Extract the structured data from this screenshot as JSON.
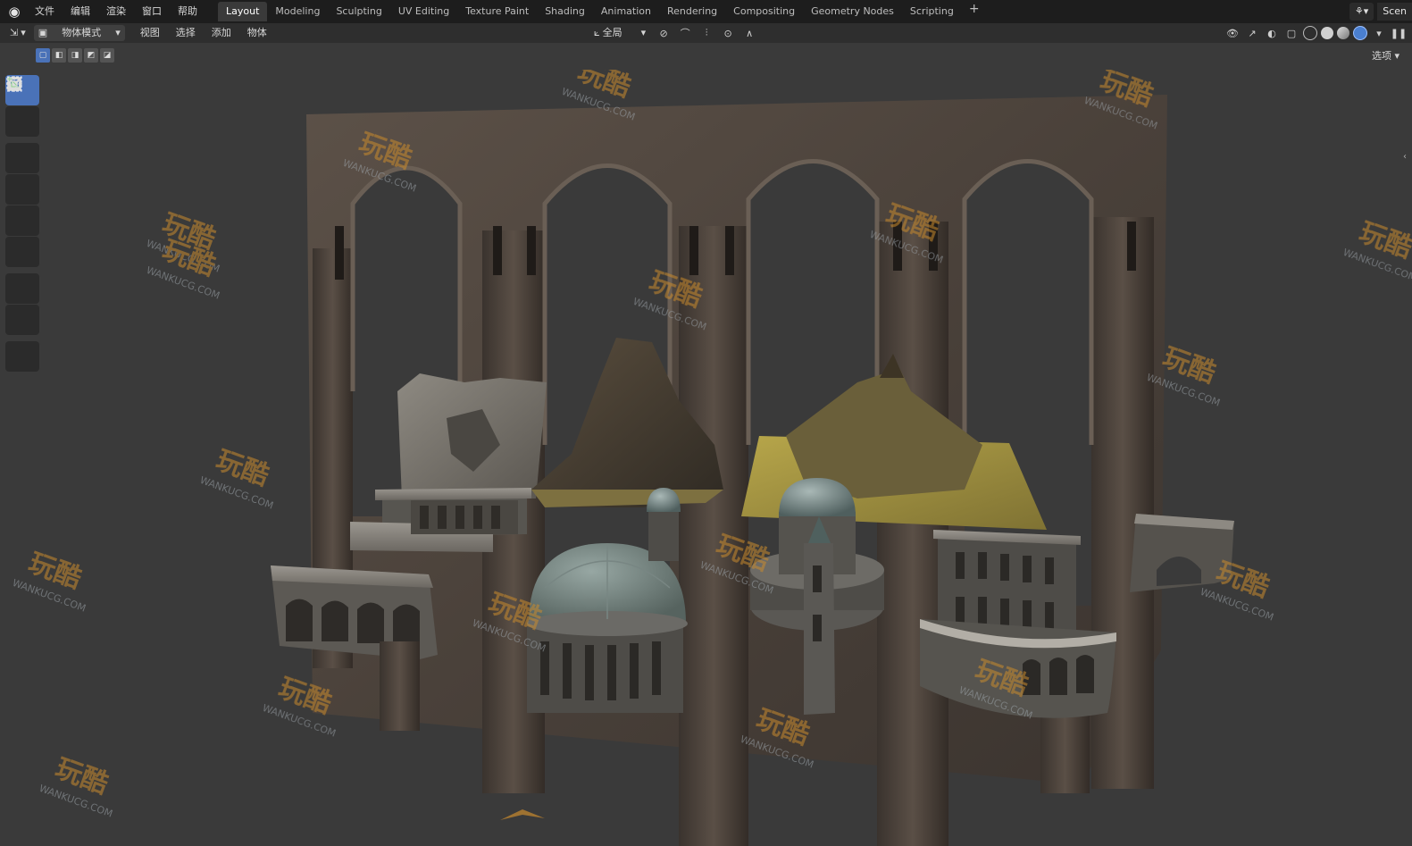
{
  "topbar": {
    "menu": [
      "文件",
      "编辑",
      "渲染",
      "窗口",
      "帮助"
    ],
    "workspaces": [
      "Layout",
      "Modeling",
      "Sculpting",
      "UV Editing",
      "Texture Paint",
      "Shading",
      "Animation",
      "Rendering",
      "Compositing",
      "Geometry Nodes",
      "Scripting"
    ],
    "active_workspace": "Layout",
    "add_label": "+",
    "scene_label": "Scen"
  },
  "header": {
    "mode": "物体模式",
    "menus": [
      "视图",
      "选择",
      "添加",
      "物体"
    ],
    "orientation": "全局",
    "options": "选项"
  },
  "watermark": {
    "brand": "玩酷",
    "site": "WANKUCG.COM"
  },
  "colors": {
    "accent": "#4a72b8",
    "bg": "#3a3a3a",
    "topbar": "#1d1d1d",
    "watermark": "#c98a2e"
  }
}
